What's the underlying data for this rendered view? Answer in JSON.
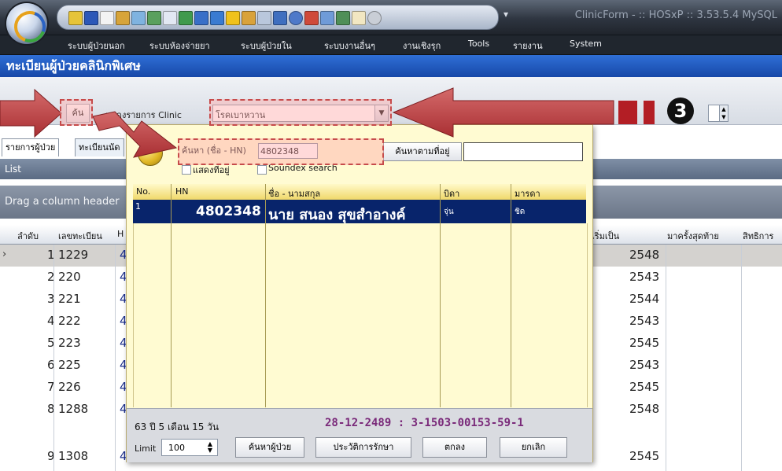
{
  "window": {
    "title": "ClinicForm - :: HOSxP :: 3.53.5.4 MySQL"
  },
  "menubar": {
    "items": [
      "ระบบผู้ป่วยนอก",
      "ระบบห้องจ่ายยา",
      "ระบบผู้ป่วยใน",
      "ระบบงานอื่นๆ",
      "งานเชิงรุก",
      "Tools",
      "รายงาน",
      "System"
    ]
  },
  "page": {
    "title": "ทะเบียนผู้ป่วยคลินิกพิเศษ"
  },
  "filter": {
    "search_button": "ค้น",
    "clinic_label": "แสดงรายการ Clinic",
    "clinic_value": "โรคเบาหวาน",
    "badge_number": "3"
  },
  "tabs": [
    "รายการผู้ป่วย",
    "ทะเบียนนัด"
  ],
  "list": {
    "title": "List",
    "group_hint": "Drag a column header",
    "columns": [
      "ลำดับ",
      "เลขทะเบียน",
      "H",
      "เริ่มเป็น",
      "มาครั้งสุดท้าย",
      "สิทธิการ"
    ],
    "rows": [
      {
        "no": "1",
        "reg": "1229",
        "h": "4",
        "start": "2548"
      },
      {
        "no": "2",
        "reg": "220",
        "h": "4",
        "start": "2543"
      },
      {
        "no": "3",
        "reg": "221",
        "h": "4",
        "start": "2544"
      },
      {
        "no": "4",
        "reg": "222",
        "h": "4",
        "start": "2543"
      },
      {
        "no": "5",
        "reg": "223",
        "h": "4",
        "start": "2545"
      },
      {
        "no": "6",
        "reg": "225",
        "h": "4",
        "start": "2543"
      },
      {
        "no": "7",
        "reg": "226",
        "h": "4",
        "start": "2545"
      },
      {
        "no": "8",
        "reg": "1288",
        "h": "4",
        "start": "2548"
      },
      {
        "no": "9",
        "reg": "1308",
        "h": "4",
        "start": "2545"
      }
    ]
  },
  "popup": {
    "search_label": "ค้นหา (ชื่อ - HN)",
    "search_value": "4802348",
    "address_search_button": "ค้นหาตามที่อยู่",
    "address_value": "",
    "show_address_label": "แสดงที่อยู่",
    "soundex_label": "Soundex search",
    "columns": [
      "No.",
      "HN",
      "ชื่อ - นามสกุล",
      "บิดา",
      "มารดา"
    ],
    "result": {
      "no": "1",
      "hn": "4802348",
      "name": "นาย สนอง  สุขสำอางค์",
      "father": "จุ่น",
      "mother": "ชิด"
    },
    "age": "63 ปี 5 เดือน 15 วัน",
    "dob_id": "28-12-2489  :  3-1503-00153-59-1",
    "limit_label": "Limit",
    "limit_value": "100",
    "buttons": {
      "search_patient": "ค้นหาผู้ป่วย",
      "history": "ประวัติการรักษา",
      "ok": "ตกลง",
      "cancel": "ยกเลิก"
    }
  },
  "colors": {
    "title_blue": "#1f5cc4",
    "callout_red": "#c64b4b",
    "selected_row": "#08246b",
    "popup_bg": "#fffbd2"
  }
}
